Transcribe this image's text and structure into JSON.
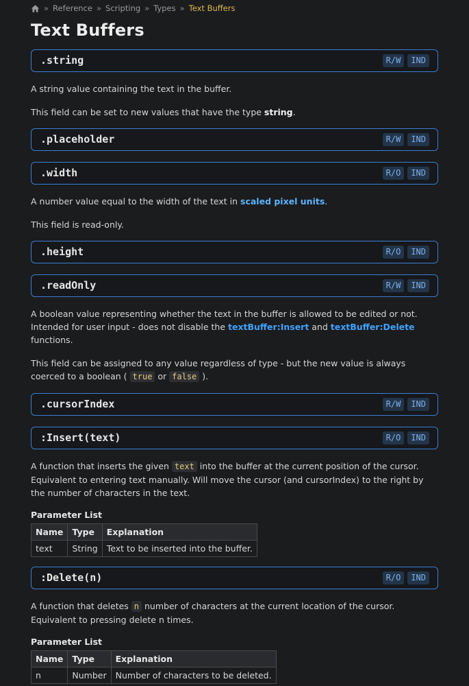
{
  "breadcrumb": [
    "Reference",
    "Scripting",
    "Types"
  ],
  "breadcrumb_current": "Text Buffers",
  "page_title": "Text Buffers",
  "members": {
    "string": {
      "name": ".string",
      "access": "R/W",
      "scope": "IND"
    },
    "placeholder": {
      "name": ".placeholder",
      "access": "R/W",
      "scope": "IND"
    },
    "width": {
      "name": ".width",
      "access": "R/O",
      "scope": "IND"
    },
    "height": {
      "name": ".height",
      "access": "R/O",
      "scope": "IND"
    },
    "readOnly": {
      "name": ".readOnly",
      "access": "R/W",
      "scope": "IND"
    },
    "cursorIndex": {
      "name": ".cursorIndex",
      "access": "R/W",
      "scope": "IND"
    },
    "insert": {
      "name": ":Insert(text)",
      "access": "R/O",
      "scope": "IND"
    },
    "delete": {
      "name": ":Delete(n)",
      "access": "R/O",
      "scope": "IND"
    }
  },
  "text": {
    "string_desc": "A string value containing the text in the buffer.",
    "string_set_a": "This field can be set to new values that have the type ",
    "string_set_type": "string",
    "string_set_b": ".",
    "width_desc_a": "A number value equal to the width of the text in ",
    "width_desc_link": "scaled pixel units",
    "width_desc_b": ".",
    "width_ro": "This field is read-only.",
    "readonly_desc_a": "A boolean value representing whether the text in the buffer is allowed to be edited or not. Intended for user input - does not disable the ",
    "readonly_link1": "textBuffer:Insert",
    "readonly_and": " and ",
    "readonly_link2": "textBuffer:Delete",
    "readonly_desc_b": " functions.",
    "readonly_assign_a": "This field can be assigned to any value regardless of type - but the new value is always coerced to a boolean ( ",
    "code_true": "true",
    "or": " or ",
    "code_false": "false",
    "readonly_assign_b": " ).",
    "insert_desc_a": "A function that inserts the given ",
    "code_text": "text",
    "insert_desc_b": " into the buffer at the current position of the cursor. Equivalent to entering text manually. Will move the cursor (and cursorIndex) to the right by the number of characters in the text.",
    "delete_desc_a": "A function that deletes ",
    "code_n": "n",
    "delete_desc_b": " number of characters at the current location of the cursor. Equivalent to pressing delete n times.",
    "param_list": "Parameter List"
  },
  "insert_params": {
    "headers": [
      "Name",
      "Type",
      "Explanation"
    ],
    "rows": [
      [
        "text",
        "String",
        "Text to be inserted into the buffer."
      ]
    ]
  },
  "delete_params": {
    "headers": [
      "Name",
      "Type",
      "Explanation"
    ],
    "rows": [
      [
        "n",
        "Number",
        "Number of characters to be deleted."
      ]
    ]
  }
}
